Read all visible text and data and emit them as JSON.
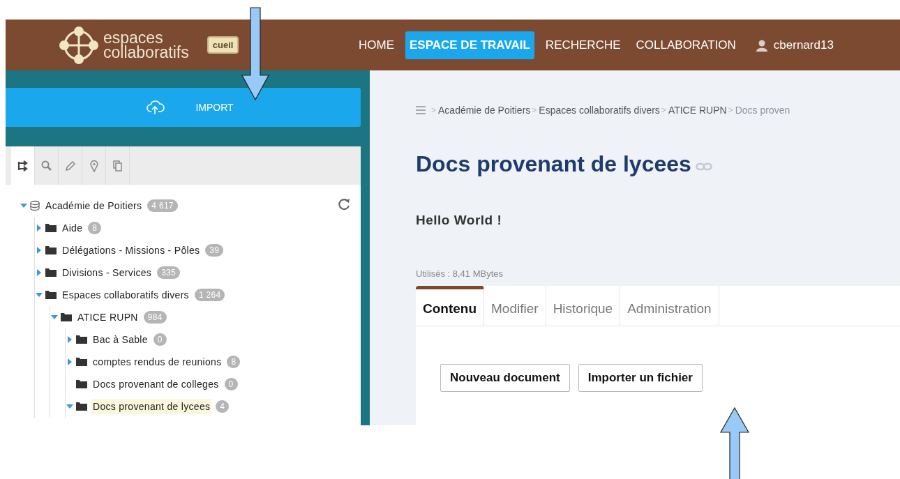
{
  "header": {
    "logo_line1": "espaces",
    "logo_line2": "collaboratifs",
    "badge": "cueil",
    "nav": [
      {
        "label": "HOME",
        "selected": false
      },
      {
        "label": "ESPACE DE TRAVAIL",
        "selected": true
      },
      {
        "label": "RECHERCHE",
        "selected": false
      },
      {
        "label": "COLLABORATION",
        "selected": false
      }
    ],
    "user": "cbernard13"
  },
  "sidebar": {
    "import_button": "IMPORT",
    "tool_tabs": [
      {
        "kind": "tree",
        "selected": true
      },
      {
        "kind": "search",
        "selected": false
      },
      {
        "kind": "pencil",
        "selected": false
      },
      {
        "kind": "pin",
        "selected": false
      },
      {
        "kind": "copy",
        "selected": false
      }
    ],
    "tree": [
      {
        "label": "Académie de Poitiers",
        "count": "4 617",
        "kind": "database",
        "expandable": true,
        "expanded": true,
        "selected": false,
        "children": [
          {
            "label": "Aide",
            "count": "8",
            "kind": "folder",
            "expandable": true,
            "expanded": false,
            "selected": false
          },
          {
            "label": "Délégations - Missions - Pôles",
            "count": "39",
            "kind": "folder",
            "expandable": true,
            "expanded": false,
            "selected": false
          },
          {
            "label": "Divisions - Services",
            "count": "335",
            "kind": "folder",
            "expandable": true,
            "expanded": false,
            "selected": false
          },
          {
            "label": "Espaces collaboratifs divers",
            "count": "1 264",
            "kind": "folder",
            "expandable": true,
            "expanded": true,
            "selected": false,
            "children": [
              {
                "label": "ATICE RUPN",
                "count": "984",
                "kind": "folder",
                "expandable": true,
                "expanded": true,
                "selected": false,
                "children": [
                  {
                    "label": "Bac à Sable",
                    "count": "0",
                    "kind": "folder",
                    "expandable": true,
                    "expanded": false,
                    "selected": false
                  },
                  {
                    "label": "comptes rendus de reunions",
                    "count": "8",
                    "kind": "folder",
                    "expandable": true,
                    "expanded": false,
                    "selected": false
                  },
                  {
                    "label": "Docs provenant de colleges",
                    "count": "0",
                    "kind": "folder",
                    "expandable": false,
                    "selected": false
                  },
                  {
                    "label": "Docs provenant de lycees",
                    "count": "4",
                    "kind": "folder",
                    "expandable": true,
                    "expanded": true,
                    "selected": true
                  }
                ]
              }
            ]
          }
        ]
      }
    ]
  },
  "content": {
    "breadcrumb": [
      {
        "separator": ">",
        "label": "Académie de Poitiers",
        "current": false
      },
      {
        "separator": ">",
        "label": "Espaces collaboratifs divers",
        "current": false
      },
      {
        "separator": ">",
        "label": "ATICE RUPN",
        "current": false
      },
      {
        "separator": ">",
        "label": "Docs proven",
        "current": true
      }
    ],
    "title": "Docs provenant de lycees",
    "description": "Hello World !",
    "usage": "Utilisés : 8,41 MBytes",
    "tabs": [
      {
        "label": "Contenu",
        "selected": true
      },
      {
        "label": "Modifier",
        "selected": false
      },
      {
        "label": "Historique",
        "selected": false
      },
      {
        "label": "Administration",
        "selected": false
      }
    ],
    "buttons": [
      "Nouveau document",
      "Importer un fichier"
    ]
  }
}
